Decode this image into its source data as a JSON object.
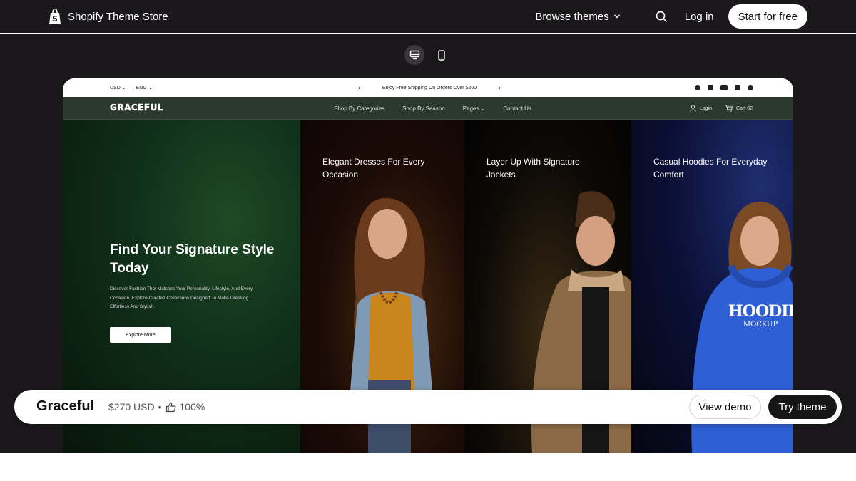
{
  "header": {
    "brand": "Shopify Theme Store",
    "browse_label": "Browse themes",
    "login_label": "Log in",
    "start_label": "Start for free"
  },
  "device_toggle": {
    "selected": "desktop",
    "options": [
      "desktop",
      "mobile"
    ]
  },
  "preview": {
    "announcement": {
      "currency": "USD",
      "language": "ENG",
      "message": "Enjoy Free Shipping On Orders Over $200",
      "social_icons": [
        "facebook-icon",
        "x-icon",
        "youtube-icon",
        "instagram-icon",
        "dribbble-icon"
      ]
    },
    "nav": {
      "logo": "GRACEFUL",
      "links": [
        "Shop By Categories",
        "Shop By Season",
        "Pages",
        "Contact Us"
      ],
      "login": "Login",
      "cart": "Cart 02"
    },
    "hero": {
      "title": "Find Your Signature Style Today",
      "text": "Discover Fashion That Matches Your Personality, Lifestyle, And Every Occasion. Explore Curated Collections Designed To Make Dressing Effortless And Stylish.",
      "button": "Explore More"
    },
    "panels": [
      {
        "caption": "Elegant Dresses For Every Occasion"
      },
      {
        "caption": "Layer Up With Signature Jackets"
      },
      {
        "caption": "Casual Hoodies For Everyday Comfort"
      }
    ],
    "hoodie_print": [
      "HOODIE",
      "MOCKUP"
    ]
  },
  "theme": {
    "name": "Graceful",
    "price": "$270 USD",
    "separator": "•",
    "rating": "100%",
    "view_demo": "View demo",
    "try_theme": "Try theme"
  },
  "colors": {
    "header_bg": "#1a181b",
    "nav_bg": "#2a3a2c",
    "try_bg": "#161616",
    "hoodie_blue": "#2f5fd4"
  }
}
